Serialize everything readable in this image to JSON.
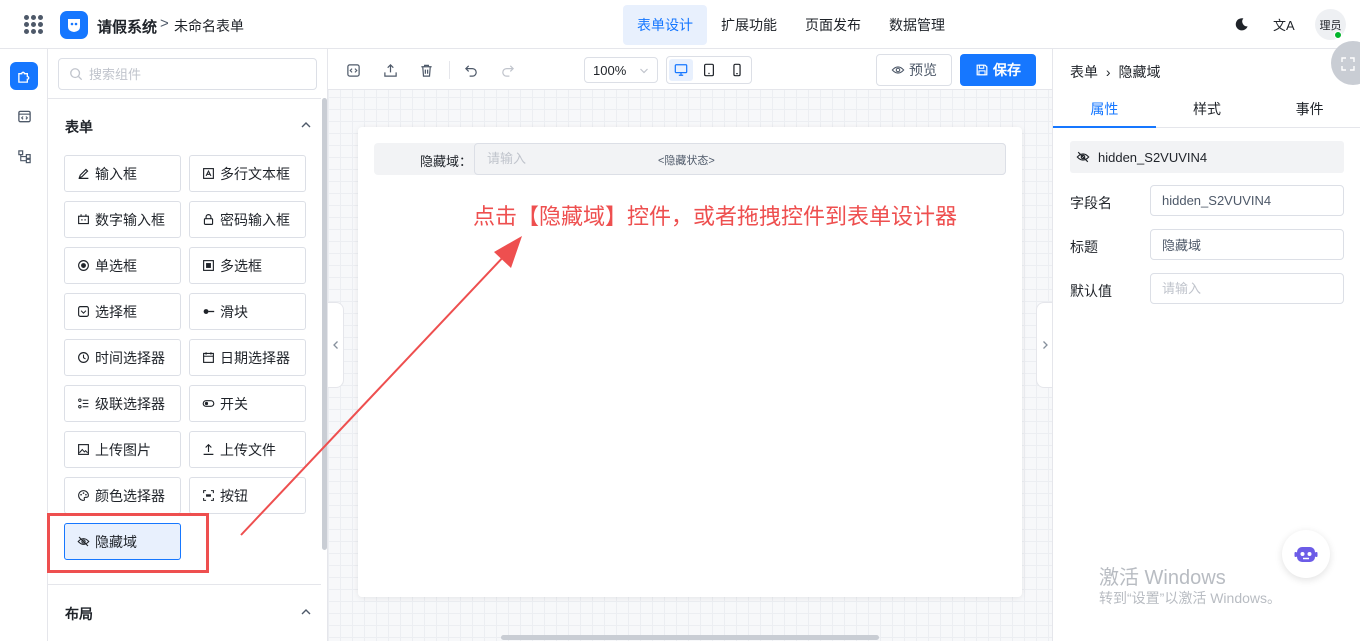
{
  "header": {
    "app_name": "请假系统",
    "breadcrumb_sep": ">",
    "form_name": "未命名表单",
    "tabs": [
      "表单设计",
      "扩展功能",
      "页面发布",
      "数据管理"
    ],
    "active_tab": 0,
    "lang_glyph": "文A",
    "avatar_text": "理员"
  },
  "component_panel": {
    "search_placeholder": "搜索组件",
    "sections": [
      {
        "title": "表单",
        "components": [
          {
            "label": "输入框",
            "icon": "pencil-icon"
          },
          {
            "label": "多行文本框",
            "icon": "textarea-icon"
          },
          {
            "label": "数字输入框",
            "icon": "number-icon"
          },
          {
            "label": "密码输入框",
            "icon": "lock-icon"
          },
          {
            "label": "单选框",
            "icon": "radio-icon"
          },
          {
            "label": "多选框",
            "icon": "checkbox-icon"
          },
          {
            "label": "选择框",
            "icon": "select-icon"
          },
          {
            "label": "滑块",
            "icon": "slider-icon"
          },
          {
            "label": "时间选择器",
            "icon": "clock-icon"
          },
          {
            "label": "日期选择器",
            "icon": "calendar-icon"
          },
          {
            "label": "级联选择器",
            "icon": "cascader-icon"
          },
          {
            "label": "开关",
            "icon": "switch-icon"
          },
          {
            "label": "上传图片",
            "icon": "image-icon"
          },
          {
            "label": "上传文件",
            "icon": "upload-icon"
          },
          {
            "label": "颜色选择器",
            "icon": "palette-icon"
          },
          {
            "label": "按钮",
            "icon": "button-icon"
          },
          {
            "label": "隐藏域",
            "icon": "eye-off-icon",
            "selected": true
          }
        ]
      },
      {
        "title": "布局",
        "components": []
      }
    ]
  },
  "toolbar": {
    "zoom": "100%",
    "preview_label": "预览",
    "save_label": "保存",
    "active_device": "desktop"
  },
  "canvas": {
    "field_label": "隐藏域：",
    "field_placeholder": "请输入",
    "hidden_state": "<隐藏状态>",
    "annotation": "点击【隐藏域】控件，或者拖拽控件到表单设计器"
  },
  "properties": {
    "breadcrumb": [
      "表单",
      "隐藏域"
    ],
    "tabs": [
      "属性",
      "样式",
      "事件"
    ],
    "active_tab": 0,
    "component_id": "hidden_S2VUVIN4",
    "fields": {
      "field_name_label": "字段名",
      "field_name_value": "hidden_S2VUVIN4",
      "title_label": "标题",
      "title_value": "隐藏域",
      "default_label": "默认值",
      "default_placeholder": "请输入"
    }
  },
  "watermark": {
    "line1": "激活 Windows",
    "line2": "转到“设置”以激活 Windows。"
  },
  "colors": {
    "primary": "#1677ff",
    "annotation_red": "#ee4f4f",
    "online_green": "#00b42a"
  }
}
